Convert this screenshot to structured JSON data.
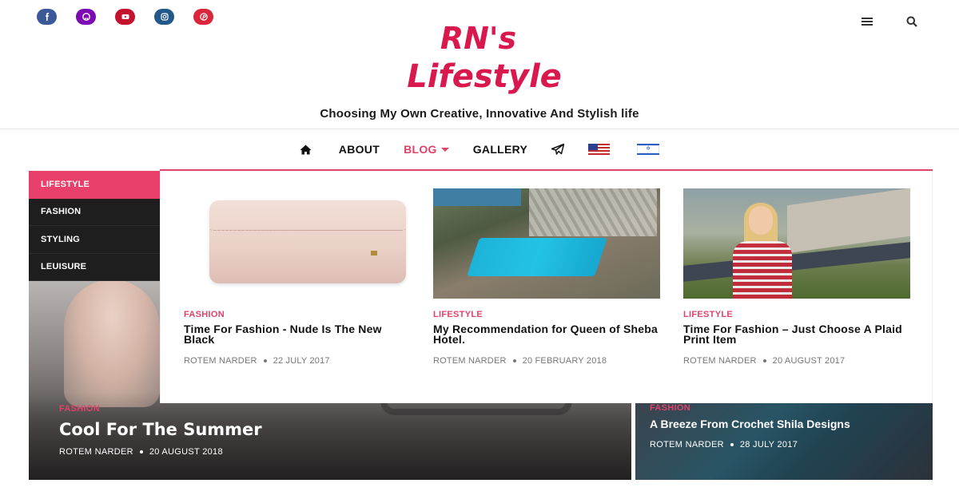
{
  "colors": {
    "brand": "#d9184e",
    "accent": "#e0436a",
    "menu_dark": "#1e1e1e",
    "menu_active": "#e9406b"
  },
  "social": [
    {
      "name": "facebook",
      "icon": "facebook-icon",
      "color": "#3b5998"
    },
    {
      "name": "github",
      "icon": "github-icon",
      "color": "#7b0ab5"
    },
    {
      "name": "youtube",
      "icon": "youtube-icon",
      "color": "#c4112d"
    },
    {
      "name": "instagram",
      "icon": "instagram-icon",
      "color": "#22588a"
    },
    {
      "name": "pinterest",
      "icon": "pinterest-icon",
      "color": "#d9263a"
    }
  ],
  "header": {
    "logo_line1": "RN's",
    "logo_line2": "Lifestyle",
    "tagline": "Choosing My Own Creative, Innovative And Stylish life",
    "icons": [
      "hamburger-menu-icon",
      "search-icon"
    ]
  },
  "nav": {
    "home_icon": "home-icon",
    "about": "ABOUT",
    "blog": "BLOG",
    "gallery": "GALLERY",
    "contact_icon": "paper-plane-icon",
    "flags": [
      "us-flag-icon",
      "israel-flag-icon"
    ]
  },
  "mega_menu": {
    "categories": [
      {
        "label": "LIFESTYLE",
        "active": true
      },
      {
        "label": "FASHION",
        "active": false
      },
      {
        "label": "STYLING",
        "active": false
      },
      {
        "label": "LEUISURE",
        "active": false
      }
    ],
    "posts": [
      {
        "category": "FASHION",
        "title": "Time For Fashion - Nude Is The New Black",
        "author": "ROTEM NARDER",
        "date": "22 JULY 2017"
      },
      {
        "category": "LIFESTYLE",
        "title": "My Recommendation for Queen of Sheba Hotel.",
        "author": "ROTEM NARDER",
        "date": "20 FEBRUARY 2018"
      },
      {
        "category": "LIFESTYLE",
        "title": "Time For Fashion – Just Choose A Plaid Print Item",
        "author": "ROTEM NARDER",
        "date": "20 AUGUST 2017"
      }
    ]
  },
  "featured": {
    "left": {
      "category": "FASHION",
      "title": "Cool For The Summer",
      "author": "ROTEM NARDER",
      "date": "20 AUGUST 2018"
    },
    "right": {
      "category": "FASHION",
      "title": "A Breeze From Crochet Shila Designs",
      "author": "ROTEM NARDER",
      "date": "28 JULY 2017"
    }
  }
}
